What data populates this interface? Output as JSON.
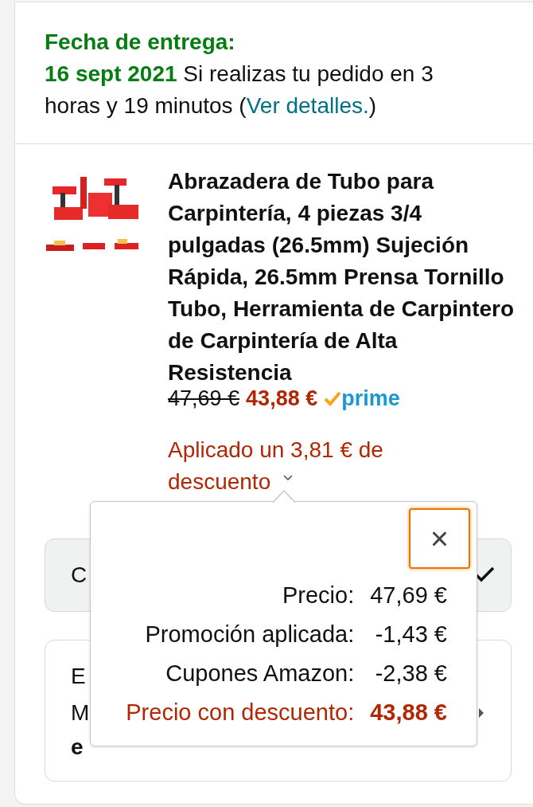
{
  "delivery": {
    "heading": "Fecha de entrega:",
    "date": "16 sept 2021",
    "message": "Si realizas tu pedido en 3 horas y 19 minutos (",
    "link": "Ver detalles.",
    "message_end": ")"
  },
  "product": {
    "title": "Abrazadera de Tubo para Carpintería, 4 piezas 3/4 pulgadas (26.5mm) Sujeción Rápida, 26.5mm Prensa Tornillo Tubo, Herramienta de Carpintero de Carpintería de Alta Resistencia",
    "list_price": "47,69 €",
    "price": "43,88 €",
    "badge": "prime",
    "discount_note": "Aplicado un 3,81 € de descuento"
  },
  "option_card": {
    "text": "C",
    "checked": true
  },
  "gift_card": {
    "lines": [
      "E",
      "M"
    ],
    "bold_line": "e"
  },
  "popover": {
    "close": "×",
    "rows": [
      {
        "label": "Precio:",
        "value": "47,69 €",
        "kind": "normal"
      },
      {
        "label": "Promoción aplicada:",
        "value": "-1,43 €",
        "kind": "normal"
      },
      {
        "label": "Cupones Amazon:",
        "value": "-2,38 €",
        "kind": "normal"
      },
      {
        "label": "Precio con descuento:",
        "value": "43,88 €",
        "kind": "total"
      }
    ]
  }
}
